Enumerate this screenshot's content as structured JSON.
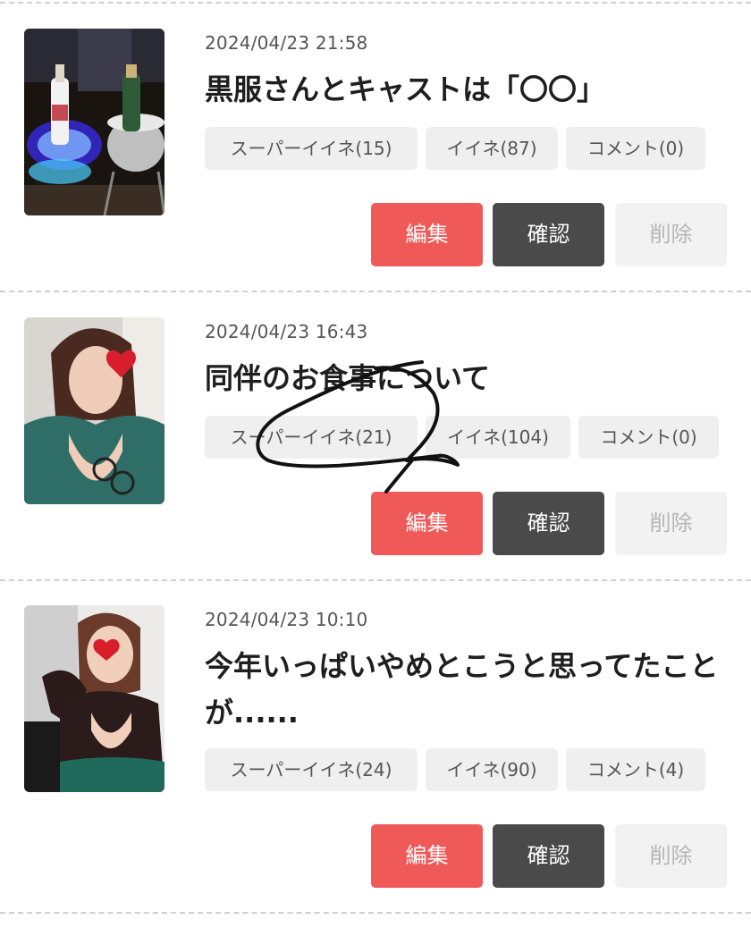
{
  "posts": [
    {
      "date": "2024/04/23 21:58",
      "title": "黒服さんとキャストは「〇〇」",
      "super_like": "スーパーイイネ(15)",
      "like": "イイネ(87)",
      "comment": "コメント(0)",
      "edit_label": "編集",
      "confirm_label": "確認",
      "delete_label": "削除"
    },
    {
      "date": "2024/04/23 16:43",
      "title": "同伴のお食事について",
      "super_like": "スーパーイイネ(21)",
      "like": "イイネ(104)",
      "comment": "コメント(0)",
      "edit_label": "編集",
      "confirm_label": "確認",
      "delete_label": "削除"
    },
    {
      "date": "2024/04/23 10:10",
      "title": "今年いっぱいやめとこうと思ってたことが......",
      "super_like": "スーパーイイネ(24)",
      "like": "イイネ(90)",
      "comment": "コメント(4)",
      "edit_label": "編集",
      "confirm_label": "確認",
      "delete_label": "削除"
    }
  ],
  "colors": {
    "edit": "#ef5a59",
    "confirm": "#4a4a4a",
    "delete_bg": "#f2f2f2",
    "chip_bg": "#efefef",
    "separator": "#cfcfcf"
  }
}
